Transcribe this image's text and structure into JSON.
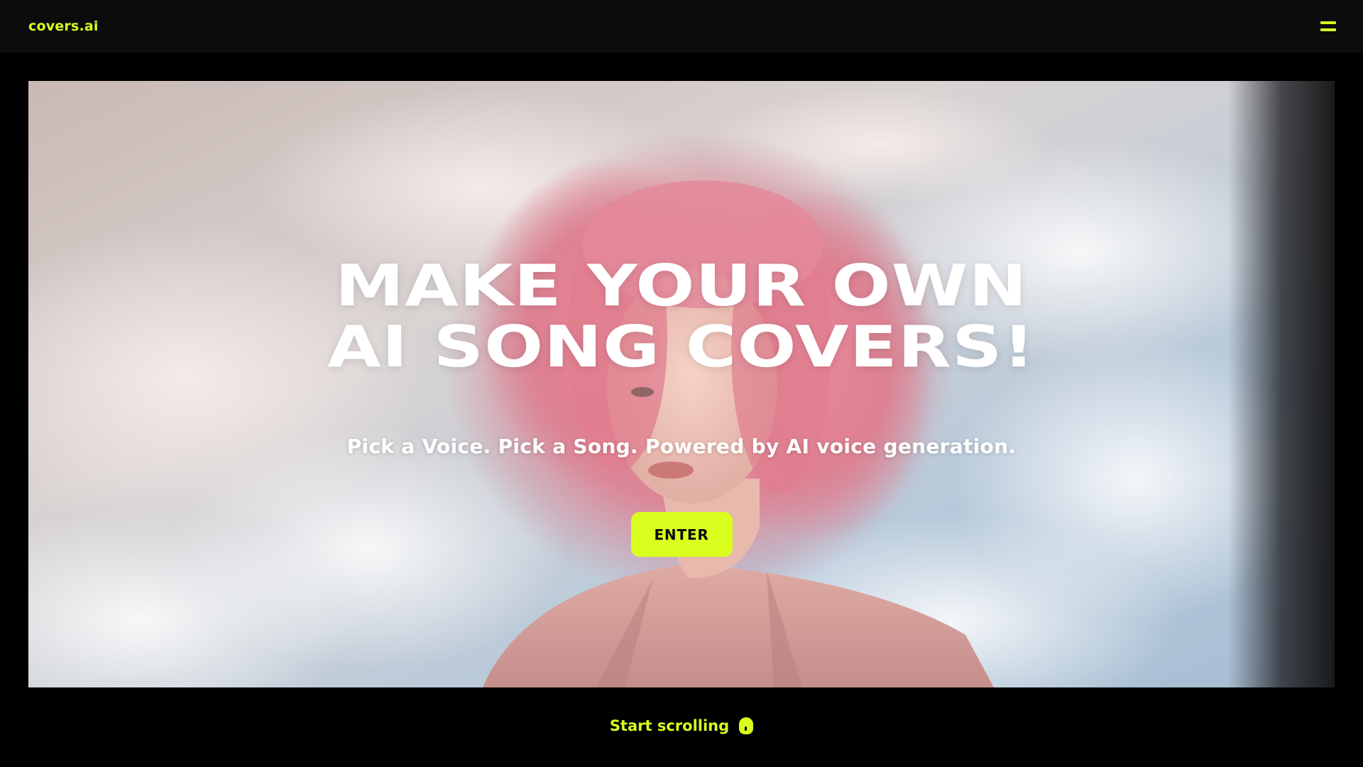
{
  "header": {
    "logo_text": "covers.ai",
    "menu_icon": "hamburger-menu-icon"
  },
  "hero": {
    "headline_line1": "MAKE YOUR OWN",
    "headline_line2": "AI SONG COVERS!",
    "subheadline": "Pick a Voice. Pick a Song. Powered by AI voice generation.",
    "cta_label": "ENTER",
    "background_image": "pink-haired-woman-against-cloudy-sky"
  },
  "footer": {
    "scroll_hint": "Start scrolling",
    "scroll_icon": "mouse-icon"
  },
  "colors": {
    "accent": "#d8ff1e",
    "topbar_bg": "#0c0c0c",
    "page_bg": "#000000",
    "text_light": "#ffffff"
  }
}
